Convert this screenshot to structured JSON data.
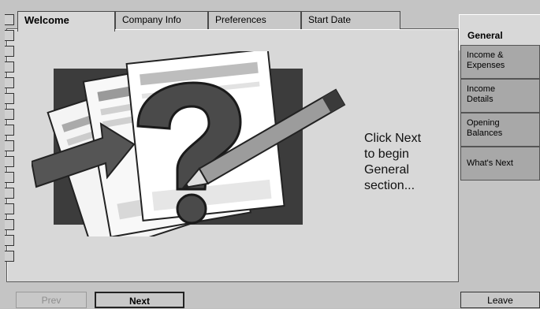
{
  "tabs": [
    {
      "label": "Welcome"
    },
    {
      "label": "Company Info"
    },
    {
      "label": "Preferences"
    },
    {
      "label": "Start Date"
    }
  ],
  "prompt": [
    "Click Next",
    "to begin",
    "General",
    "section..."
  ],
  "sidebar": {
    "header": "General",
    "items": [
      {
        "line1": "Income &",
        "line2": "Expenses"
      },
      {
        "line1": "Income",
        "line2": "Details"
      },
      {
        "line1": "Opening",
        "line2": "Balances"
      },
      {
        "line1": "What's Next",
        "line2": ""
      }
    ]
  },
  "buttons": {
    "prev": "Prev",
    "next": "Next",
    "leave": "Leave"
  },
  "illustration": {
    "icon": "question-mark-icon"
  }
}
